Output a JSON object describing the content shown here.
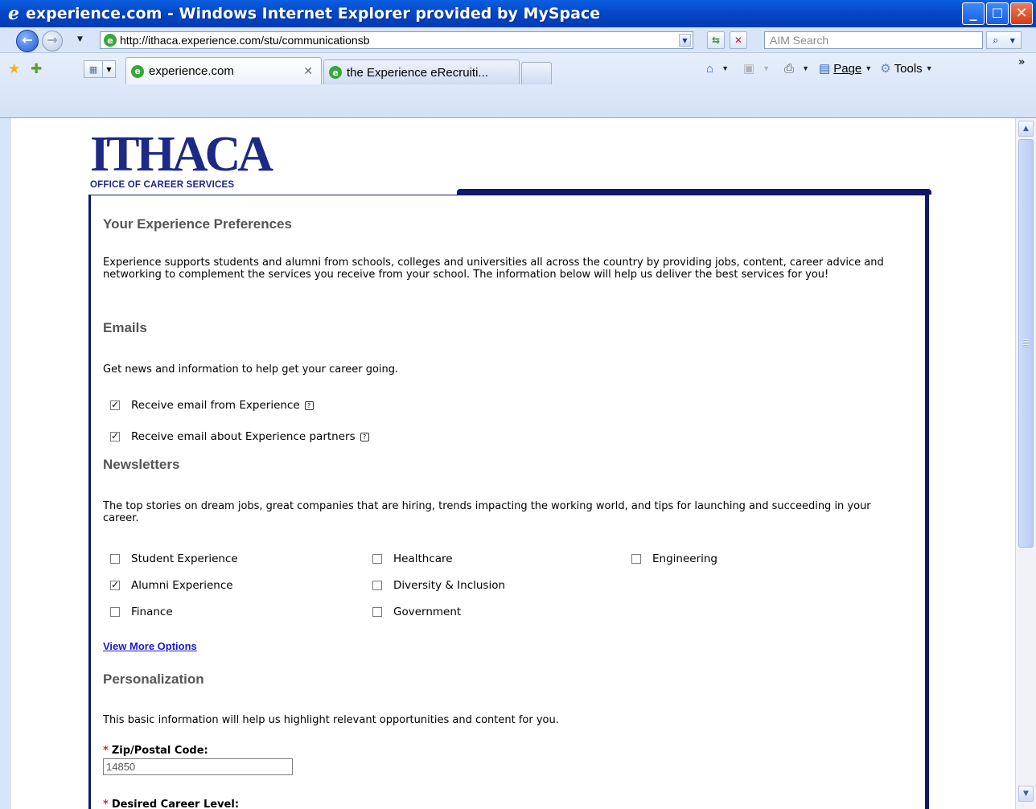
{
  "window": {
    "title": "experience.com - Windows Internet Explorer provided by MySpace",
    "minimize_glyph": "_",
    "maximize_glyph": "☐",
    "close_glyph": "✕"
  },
  "address_bar": {
    "url": "http://ithaca.experience.com/stu/communicationsb",
    "search_placeholder": "AIM Search"
  },
  "tabs": [
    {
      "label": "experience.com",
      "active": true
    },
    {
      "label": "the Experience eRecruiti...",
      "active": false
    }
  ],
  "command_bar": {
    "page_label": "Page",
    "tools_label": "Tools"
  },
  "page": {
    "logo_text": "ITHACA",
    "logo_subtitle": "OFFICE OF CAREER SERVICES",
    "preferences_heading": "Your Experience Preferences",
    "intro": "Experience supports students and alumni from schools, colleges and universities all across the country by providing jobs, content, career advice and networking to complement the services you receive from your school. The information below will help us deliver the best services for you!",
    "emails": {
      "heading": "Emails",
      "description": "Get news and information to help get your career going.",
      "options": [
        {
          "label": "Receive email from Experience",
          "checked": true
        },
        {
          "label": "Receive email about Experience partners",
          "checked": true
        }
      ]
    },
    "newsletters": {
      "heading": "Newsletters",
      "description": "The top stories on dream jobs, great companies that are hiring, trends impacting the working world, and tips for launching and succeeding in your career.",
      "options": [
        {
          "label": "Student Experience",
          "checked": false
        },
        {
          "label": "Healthcare",
          "checked": false
        },
        {
          "label": "Engineering",
          "checked": false
        },
        {
          "label": "Alumni Experience",
          "checked": true
        },
        {
          "label": "Diversity & Inclusion",
          "checked": false
        },
        {
          "label": "Finance",
          "checked": false
        },
        {
          "label": "Government",
          "checked": false
        }
      ],
      "view_more": "View More Options"
    },
    "personalization": {
      "heading": "Personalization",
      "description": "This basic information will help us highlight relevant opportunities and content for you.",
      "zip_label": "Zip/Postal Code:",
      "zip_value": "14850",
      "career_level_label": "Desired Career Level:"
    }
  },
  "icons": {
    "ie": "e-icon",
    "back": "back-arrow-icon",
    "forward": "forward-arrow-icon",
    "refresh": "refresh-icon",
    "stop": "stop-icon",
    "search": "search-icon",
    "favorites": "favorites-star-icon",
    "add_favorite": "add-favorite-icon",
    "home": "home-icon",
    "feeds": "feeds-icon",
    "print": "print-icon",
    "page": "page-icon",
    "tools": "gear-icon",
    "help": "help-icon"
  },
  "colors": {
    "titlebar": "#0448c8",
    "brand_navy": "#1c2a86",
    "panel_border": "#10186a",
    "heading_gray": "#555555",
    "link_blue": "#1a1acc",
    "required_red": "#dd2222"
  }
}
